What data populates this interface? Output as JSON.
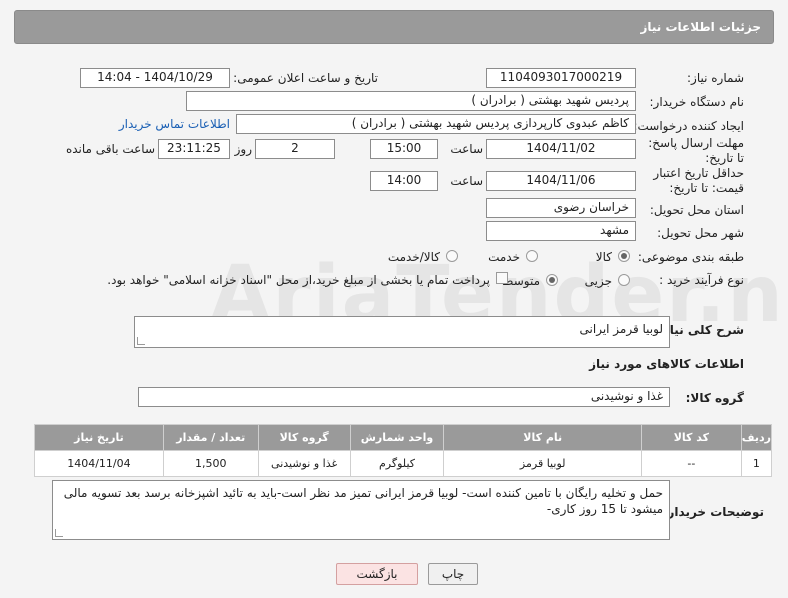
{
  "header": {
    "title": "جزئیات اطلاعات نیاز"
  },
  "fields": {
    "need_number_label": "شماره نیاز:",
    "need_number": "1104093017000219",
    "announce_label": "تاریخ و ساعت اعلان عمومی:",
    "announce_value": "1404/10/29 - 14:04",
    "buyer_org_label": "نام دستگاه خریدار:",
    "buyer_org": "پردیس شهید بهشتی ( برادران )",
    "requester_label": "ایجاد کننده درخواست:",
    "requester": "کاظم  عبدوی  کارپردازی  پردیس شهید بهشتی ( برادران )",
    "contact_link": "اطلاعات تماس خریدار",
    "reply_deadline_label": "مهلت ارسال پاسخ: تا تاریخ:",
    "reply_date": "1404/11/02",
    "time_label": "ساعت",
    "reply_time": "15:00",
    "days_value": "2",
    "days_label": "روز و",
    "remaining_value": "23:11:25",
    "remaining_label": "ساعت باقی مانده",
    "price_validity_label": "حداقل تاریخ اعتبار قیمت: تا تاریخ:",
    "price_date": "1404/11/06",
    "price_time": "14:00",
    "province_label": "استان محل تحویل:",
    "province": "خراسان رضوی",
    "city_label": "شهر محل تحویل:",
    "city": "مشهد",
    "category_label": "طبقه بندی موضوعی:",
    "category_options": [
      "کالا",
      "خدمت",
      "کالا/خدمت"
    ],
    "process_label": "نوع فرآیند خرید :",
    "process_options": [
      "جزیی",
      "متوسط"
    ],
    "payment_note": "پرداخت تمام یا بخشی از مبلغ خرید،از محل \"اسناد خزانه اسلامی\" خواهد بود."
  },
  "summary": {
    "label": "شرح کلی نیاز:",
    "value": "لوبیا قرمز ایرانی"
  },
  "goods_section": {
    "title": "اطلاعات کالاهای مورد نیاز",
    "group_label": "گروه کالا:",
    "group_value": "غذا و نوشیدنی"
  },
  "table": {
    "headers": [
      "ردیف",
      "کد کالا",
      "نام کالا",
      "واحد شمارش",
      "گروه کالا",
      "تعداد / مقدار",
      "تاریخ نیاز"
    ],
    "rows": [
      [
        "1",
        "--",
        "لوبیا قرمز",
        "کیلوگرم",
        "غذا و نوشیدنی",
        "1,500",
        "1404/11/04"
      ]
    ]
  },
  "buyer_notes": {
    "label": "توضیحات خریدار:",
    "value": "حمل و تخلیه رایگان با تامین کننده است- لوبیا قرمز ایرانی تمیز مد نظر است-باید به تائید اشپزخانه برسد بعد تسویه مالی میشود تا 15 روز کاری-"
  },
  "buttons": {
    "print": "چاپ",
    "back": "بازگشت"
  },
  "watermark": "AriaTender.net"
}
